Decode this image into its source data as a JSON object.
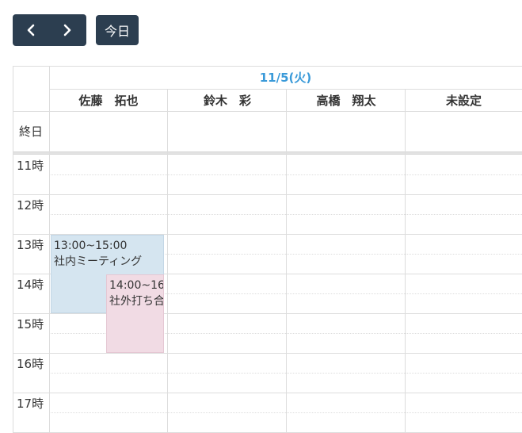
{
  "toolbar": {
    "prev_icon": "chevron-left-icon",
    "next_icon": "chevron-right-icon",
    "today_label": "今日"
  },
  "calendar": {
    "date": "11/5(火)",
    "columns": [
      {
        "label": "佐藤　拓也"
      },
      {
        "label": "鈴木　彩"
      },
      {
        "label": "高橋　翔太"
      },
      {
        "label": "未設定"
      }
    ],
    "allday_label": "終日",
    "hours": [
      "11時",
      "12時",
      "13時",
      "14時",
      "15時",
      "16時",
      "17時"
    ],
    "events": [
      {
        "time": "13:00~15:00",
        "title": "社内ミーティング",
        "color": "#d5e5f0"
      },
      {
        "time": "14:00~16",
        "title": "社外打ち合",
        "color": "#f1dbe4"
      }
    ]
  },
  "colors": {
    "button_bg": "#2c3e50",
    "date_header": "#3a9ad9",
    "grid_line": "#dddddd"
  }
}
